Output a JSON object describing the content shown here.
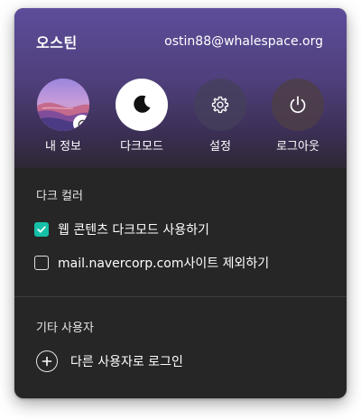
{
  "profile": {
    "name": "오스틴",
    "email": "ostin88@whalespace.org"
  },
  "actions": [
    {
      "label": "내 정보",
      "icon": "avatar-sync-icon"
    },
    {
      "label": "다크모드",
      "icon": "moon-icon"
    },
    {
      "label": "설정",
      "icon": "gear-icon"
    },
    {
      "label": "로그아웃",
      "icon": "power-icon"
    }
  ],
  "dark_color": {
    "title": "다크 컬러",
    "options": [
      {
        "label": "웹 콘텐츠 다크모드 사용하기",
        "checked": true
      },
      {
        "label": "mail.navercorp.com사이트 제외하기",
        "checked": false
      }
    ]
  },
  "other_users": {
    "title": "기타 사용자",
    "login_label": "다른 사용자로 로그인"
  },
  "colors": {
    "accent": "#16c0a8",
    "panel_bg": "#262626",
    "header_top": "#5d4d9a"
  }
}
